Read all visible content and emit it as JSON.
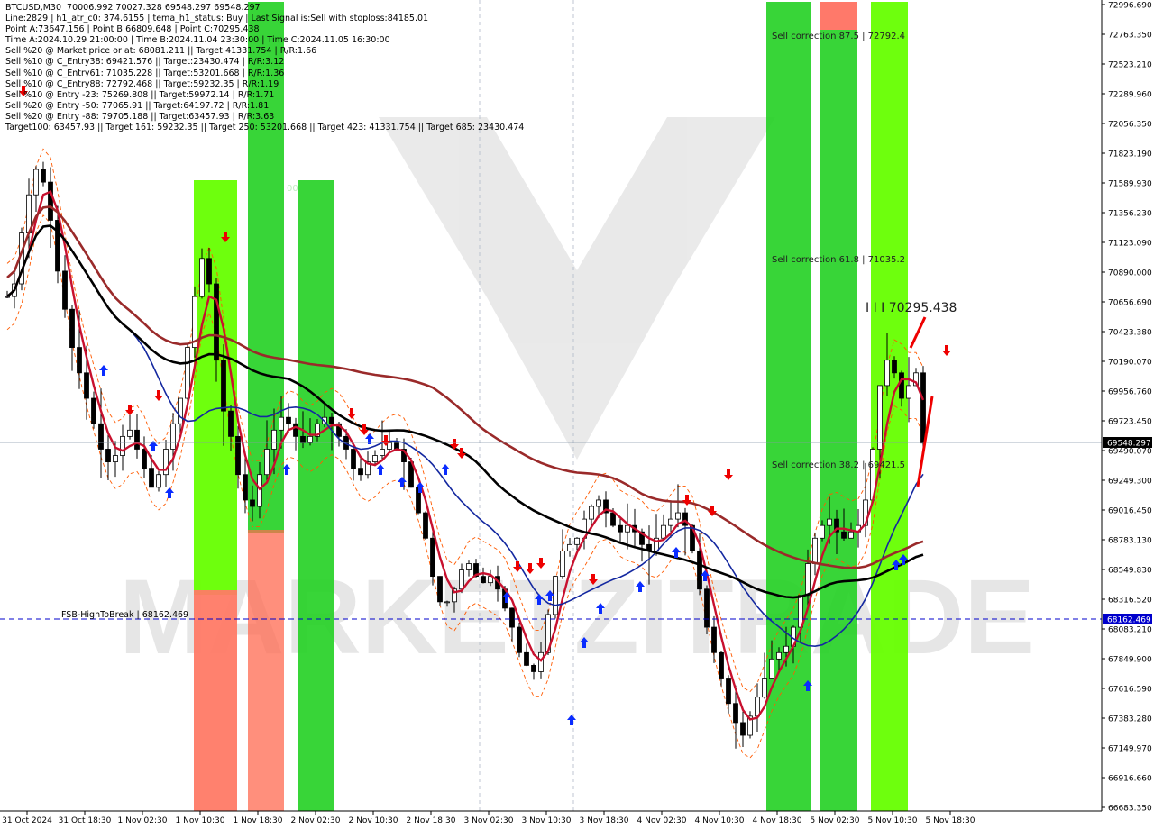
{
  "info_lines": [
    "BTCUSD,M30  70006.992 70027.328 69548.297 69548.297",
    "Line:2829 | h1_atr_c0: 374.6155 | tema_h1_status: Buy | Last Signal is:Sell with stoploss:84185.01",
    "Point A:73647.156 | Point B:66809.648 | Point C:70295.438",
    "Time A:2024.10.29 21:00:00 | Time B:2024.11.04 23:30:00 | Time C:2024.11.05 16:30:00",
    "Sell %20 @ Market price or at: 68081.211 || Target:41331.754 | R/R:1.66",
    "Sell %10 @ C_Entry38: 69421.576 || Target:23430.474 | R/R:3.12",
    "Sell %10 @ C_Entry61: 71035.228 || Target:53201.668 | R/R:1.36",
    "Sell %10 @ C_Entry88: 72792.468 || Target:59232.35 | R/R:1.19",
    "Sell %10 @ Entry -23: 75269.808 || Target:59972.14 | R/R:1.71",
    "Sell %20 @ Entry -50: 77065.91 || Target:64197.72 | R/R:1.81",
    "Sell %20 @ Entry -88: 79705.188 || Target:63457.93 | R/R:3.63",
    "Target100: 63457.93 || Target 161: 59232.35 || Target 250: 53201.668 || Target 423: 41331.754 || Target 685: 23430.474"
  ],
  "annotations": {
    "sell_correction_87": "Sell correction 87.5 | 72792.4",
    "sell_correction_61": "Sell correction 61.8 | 71035.2",
    "sell_correction_38": "Sell correction 38.2 | 69421.5",
    "point_c_label": "I I I 70295.438",
    "fsb_label": "FSB-HighToBreak | 68162.469",
    "partial_label": "00"
  },
  "price_tags": {
    "current": "69548.297",
    "fsb": "68162.469"
  },
  "watermark": "MARKETZITRADE",
  "colors": {
    "background": "#ffffff",
    "grid": "#b0b8c8",
    "candle": "#000000",
    "ma_red": "#c8102e",
    "ma_dark_red": "#9a2a2a",
    "ma_black": "#000000",
    "ma_blue": "#1428a0",
    "channel_orange": "#ff5a00",
    "zone_green": "#1fd21f",
    "zone_lime": "#66ff00",
    "zone_salmon": "#ff6a5a",
    "arrow_up": "#0a2cff",
    "arrow_down": "#ee0000",
    "fsb_line": "#0000cc"
  },
  "chart_data": {
    "type": "candlestick",
    "symbol": "BTCUSD",
    "timeframe": "M30",
    "ohlc_last": {
      "open": 70006.992,
      "high": 70027.328,
      "low": 69548.297,
      "close": 69548.297
    },
    "ylim": [
      66683.35,
      72996.65
    ],
    "y_ticks": [
      "72996.690",
      "72763.350",
      "72523.210",
      "72289.960",
      "72056.350",
      "71823.190",
      "71589.930",
      "71356.230",
      "71123.090",
      "70890.000",
      "70656.690",
      "70423.380",
      "70190.070",
      "69956.760",
      "69723.450",
      "69490.070",
      "69249.300",
      "69016.450",
      "68783.130",
      "68549.830",
      "68316.520",
      "68083.210",
      "67849.900",
      "67616.590",
      "67383.280",
      "67149.970",
      "66916.660",
      "66683.350"
    ],
    "x_ticks": [
      "31 Oct 2024",
      "31 Oct 18:30",
      "1 Nov 02:30",
      "1 Nov 10:30",
      "1 Nov 18:30",
      "2 Nov 02:30",
      "2 Nov 10:30",
      "2 Nov 18:30",
      "3 Nov 02:30",
      "3 Nov 10:30",
      "3 Nov 18:30",
      "4 Nov 02:30",
      "4 Nov 10:30",
      "4 Nov 18:30",
      "5 Nov 02:30",
      "5 Nov 10:30",
      "5 Nov 18:30"
    ],
    "key_levels": {
      "current_price": 69548.297,
      "fsb_high_to_break": 68162.469,
      "sell_correction_87_5": 72792.4,
      "sell_correction_61_8": 71035.2,
      "sell_correction_38_2": 69421.5,
      "point_c": 70295.438
    },
    "close_path": [
      [
        0,
        70700
      ],
      [
        1,
        70800
      ],
      [
        2,
        71200
      ],
      [
        3,
        71500
      ],
      [
        4,
        71700
      ],
      [
        5,
        71600
      ],
      [
        6,
        71300
      ],
      [
        7,
        70900
      ],
      [
        8,
        70600
      ],
      [
        9,
        70300
      ],
      [
        10,
        70100
      ],
      [
        11,
        69900
      ],
      [
        12,
        69700
      ],
      [
        13,
        69500
      ],
      [
        14,
        69400
      ],
      [
        15,
        69450
      ],
      [
        16,
        69600
      ],
      [
        17,
        69650
      ],
      [
        18,
        69500
      ],
      [
        19,
        69350
      ],
      [
        20,
        69200
      ],
      [
        21,
        69300
      ],
      [
        22,
        69500
      ],
      [
        23,
        69700
      ],
      [
        24,
        69900
      ],
      [
        25,
        70300
      ],
      [
        26,
        70700
      ],
      [
        27,
        71000
      ],
      [
        28,
        70800
      ],
      [
        29,
        70200
      ],
      [
        30,
        69800
      ],
      [
        31,
        69600
      ],
      [
        32,
        69300
      ],
      [
        33,
        69100
      ],
      [
        34,
        69050
      ],
      [
        35,
        69300
      ],
      [
        36,
        69500
      ],
      [
        37,
        69650
      ],
      [
        38,
        69750
      ],
      [
        39,
        69700
      ],
      [
        40,
        69600
      ],
      [
        41,
        69550
      ],
      [
        42,
        69600
      ],
      [
        43,
        69700
      ],
      [
        44,
        69750
      ],
      [
        45,
        69700
      ],
      [
        46,
        69600
      ],
      [
        47,
        69500
      ],
      [
        48,
        69350
      ],
      [
        49,
        69300
      ],
      [
        50,
        69400
      ],
      [
        51,
        69450
      ],
      [
        52,
        69500
      ],
      [
        53,
        69550
      ],
      [
        54,
        69500
      ],
      [
        55,
        69400
      ],
      [
        56,
        69200
      ],
      [
        57,
        69000
      ],
      [
        58,
        68800
      ],
      [
        59,
        68500
      ],
      [
        60,
        68300
      ],
      [
        61,
        68300
      ],
      [
        62,
        68400
      ],
      [
        63,
        68550
      ],
      [
        64,
        68600
      ],
      [
        65,
        68500
      ],
      [
        66,
        68450
      ],
      [
        67,
        68500
      ],
      [
        68,
        68400
      ],
      [
        69,
        68250
      ],
      [
        70,
        68100
      ],
      [
        71,
        67900
      ],
      [
        72,
        67800
      ],
      [
        73,
        67750
      ],
      [
        74,
        67900
      ],
      [
        75,
        68200
      ],
      [
        76,
        68500
      ],
      [
        77,
        68700
      ],
      [
        78,
        68750
      ],
      [
        79,
        68800
      ],
      [
        80,
        68950
      ],
      [
        81,
        69050
      ],
      [
        82,
        69100
      ],
      [
        83,
        69000
      ],
      [
        84,
        68900
      ],
      [
        85,
        68850
      ],
      [
        86,
        68900
      ],
      [
        87,
        68850
      ],
      [
        88,
        68750
      ],
      [
        89,
        68700
      ],
      [
        90,
        68800
      ],
      [
        91,
        68900
      ],
      [
        92,
        68950
      ],
      [
        93,
        69000
      ],
      [
        94,
        68900
      ],
      [
        95,
        68700
      ],
      [
        96,
        68400
      ],
      [
        97,
        68100
      ],
      [
        98,
        67900
      ],
      [
        99,
        67700
      ],
      [
        100,
        67500
      ],
      [
        101,
        67350
      ],
      [
        102,
        67250
      ],
      [
        103,
        67400
      ],
      [
        104,
        67550
      ],
      [
        105,
        67700
      ],
      [
        106,
        67850
      ],
      [
        107,
        67900
      ],
      [
        108,
        67950
      ],
      [
        109,
        68100
      ],
      [
        110,
        68350
      ],
      [
        111,
        68600
      ],
      [
        112,
        68800
      ],
      [
        113,
        68900
      ],
      [
        114,
        68950
      ],
      [
        115,
        68850
      ],
      [
        116,
        68800
      ],
      [
        117,
        68850
      ],
      [
        118,
        68900
      ],
      [
        119,
        69100
      ],
      [
        120,
        69500
      ],
      [
        121,
        70000
      ],
      [
        122,
        70200
      ],
      [
        123,
        70100
      ],
      [
        124,
        69900
      ],
      [
        125,
        70000
      ],
      [
        126,
        70100
      ],
      [
        127,
        69548
      ]
    ]
  }
}
